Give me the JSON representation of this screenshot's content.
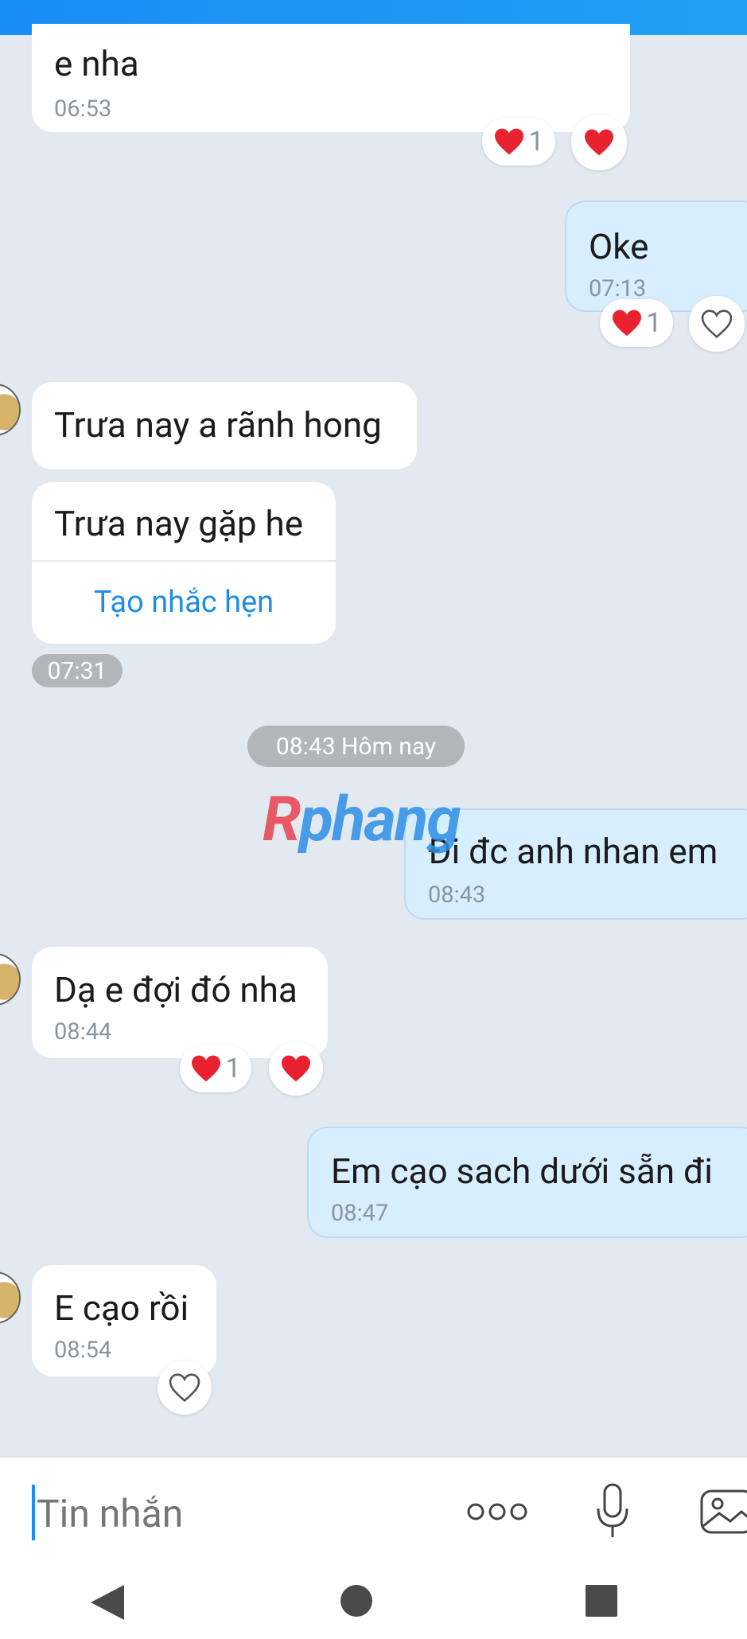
{
  "messages": [
    {
      "text": "e nha",
      "time": "06:53"
    },
    {
      "text": "Oke",
      "time": "07:13"
    },
    {
      "text": "Trưa nay a rãnh hong"
    },
    {
      "text": "Trưa nay gặp he",
      "action": "Tạo nhắc hẹn",
      "time": "07:31"
    },
    {
      "text": "Đi đc anh nhan em",
      "time": "08:43"
    },
    {
      "text": "Dạ e đợi đó nha",
      "time": "08:44"
    },
    {
      "text": "Em cạo sach dưới sẵn đi",
      "time": "08:47"
    },
    {
      "text": "E cạo rồi",
      "time": "08:54"
    }
  ],
  "date_separator": "08:43 Hôm nay",
  "reaction_count": "1",
  "watermark": {
    "first": "R",
    "rest": "phang"
  },
  "input": {
    "placeholder": "Tin nhắn"
  },
  "colors": {
    "accent": "#1a8df6",
    "bubble_mine": "#d7eefe",
    "bubble_theirs": "#ffffff",
    "background": "#e2e9f1",
    "heart": "#e8232f"
  }
}
